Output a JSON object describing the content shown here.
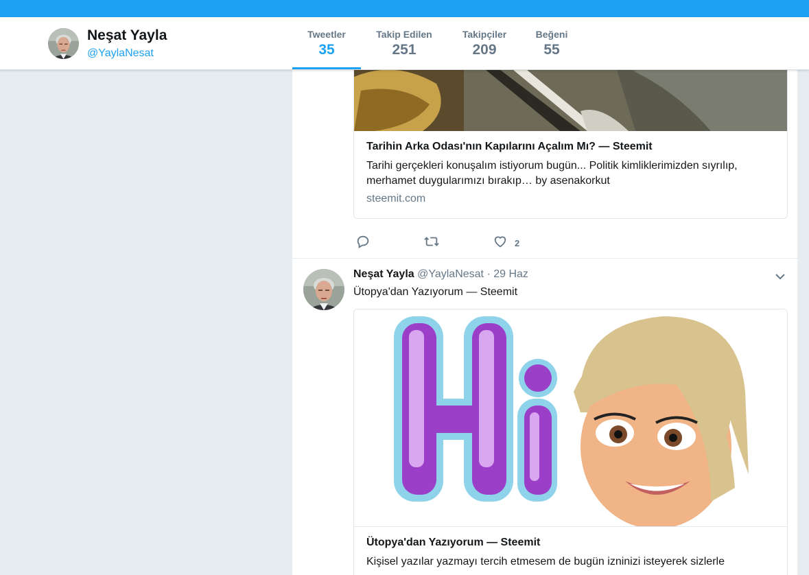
{
  "profile": {
    "name": "Neşat Yayla",
    "handle": "@YaylaNesat"
  },
  "stats": [
    {
      "label": "Tweetler",
      "value": "35",
      "active": true
    },
    {
      "label": "Takip Edilen",
      "value": "251"
    },
    {
      "label": "Takipçiler",
      "value": "209"
    },
    {
      "label": "Beğeni",
      "value": "55"
    }
  ],
  "tweet1": {
    "card_title": "Tarihin Arka Odası'nın Kapılarını Açalım Mı? — Steemit",
    "card_desc_line1": "Tarihi gerçekleri konuşalım istiyorum bugün... Politik kimliklerimizden sıyrılıp,",
    "card_desc_line2": "merhamet duygularımızı bırakıp… by asenakorkut",
    "card_domain": "steemit.com",
    "reply_icon": "reply-icon",
    "retweet_icon": "retweet-icon",
    "like_icon": "heart-icon",
    "like_count": "2"
  },
  "tweet2": {
    "name": "Neşat Yayla",
    "handle": "@YaylaNesat",
    "separator": "·",
    "date": "29 Haz",
    "text": "Ütopya'dan Yazıyorum — Steemit",
    "card_title": "Ütopya'dan Yazıyorum — Steemit",
    "card_desc_line1": "Kişisel yazılar yazmayı tercih etmesem de bugün izninizi isteyerek sizlerle",
    "image_word": "Hi"
  },
  "colors": {
    "accent": "#1da1f2",
    "muted": "#657786",
    "text": "#14171a",
    "background": "#e6ecf0"
  }
}
